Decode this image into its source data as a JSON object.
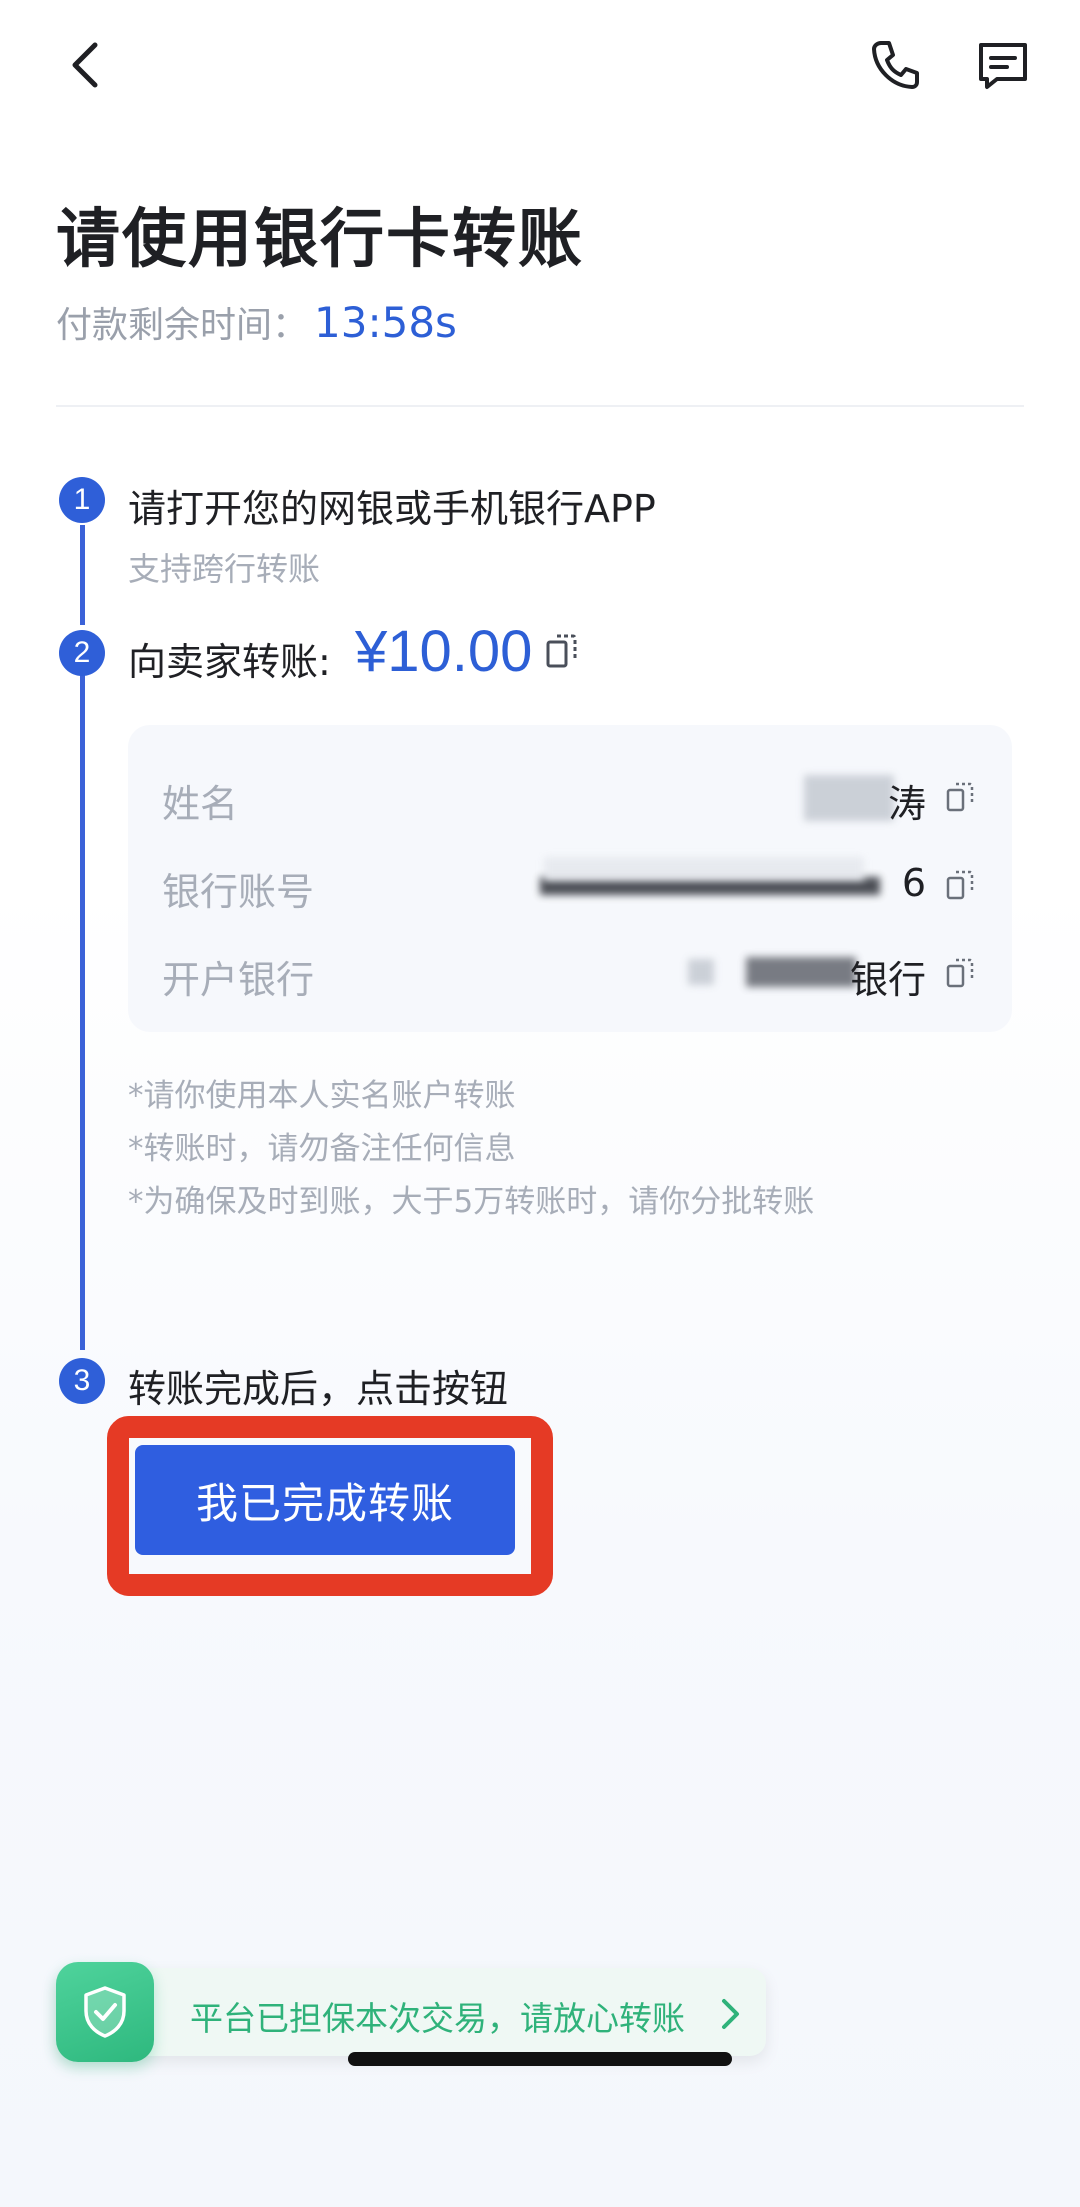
{
  "header": {
    "back_icon": "chevron-left-icon",
    "phone_icon": "phone-icon",
    "message_icon": "message-icon"
  },
  "title": "请使用银行卡转账",
  "timer": {
    "label": "付款剩余时间：",
    "value": "13:58s"
  },
  "steps": [
    {
      "number": "1",
      "title": "请打开您的网银或手机银行APP",
      "subtitle": "支持跨行转账"
    },
    {
      "number": "2",
      "title": "向卖家转账:",
      "amount": "¥10.00"
    },
    {
      "number": "3",
      "title": "转账完成后，点击按钮"
    }
  ],
  "payee": {
    "name_label": "姓名",
    "name_value": "涛",
    "account_label": "银行账号",
    "account_value": "6",
    "bank_label": "开户银行",
    "bank_value": "银行"
  },
  "notes": [
    "*请你使用本人实名账户转账",
    "*转账时，请勿备注任何信息",
    "*为确保及时到账，大于5万转账时，请你分批转账"
  ],
  "done_button": "我已完成转账",
  "guarantee": {
    "text": "平台已担保本次交易，请放心转账",
    "icon": "shield-check-icon"
  },
  "colors": {
    "accent": "#2f5fd8",
    "highlight": "#e53a25",
    "guarantee_green": "#2fb27a"
  }
}
